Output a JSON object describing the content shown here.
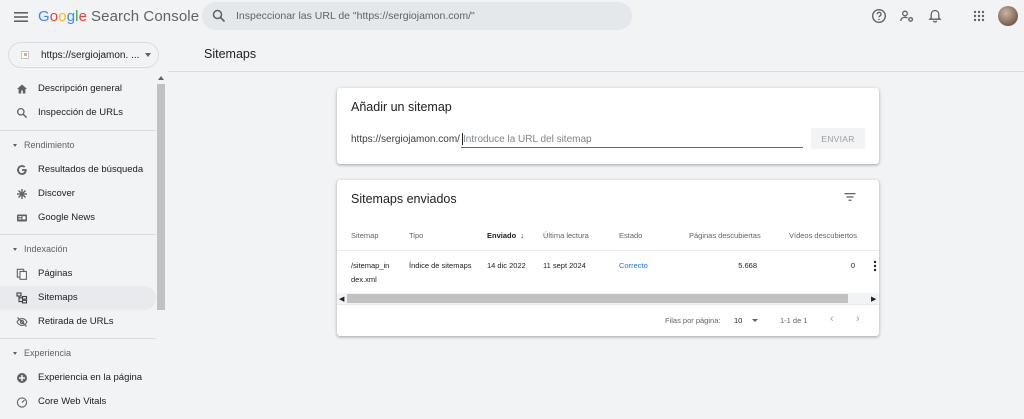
{
  "header": {
    "logo_letters": [
      "G",
      "o",
      "o",
      "g",
      "l",
      "e"
    ],
    "product_name": "Search Console",
    "search_placeholder": "Inspeccionar las URL de \"https://sergiojamon.com/\"",
    "icons": [
      "menu-icon",
      "search-icon",
      "help-icon",
      "users-settings-icon",
      "bell-icon",
      "apps-grid-icon",
      "avatar"
    ]
  },
  "property": {
    "label": "https://sergiojamon. ..."
  },
  "sidebar": {
    "items": [
      {
        "label": "Descripción general",
        "icon": "home-icon"
      },
      {
        "label": "Inspección de URLs",
        "icon": "search-icon"
      },
      {
        "label": "Resultados de búsqueda",
        "icon": "google-g-icon"
      },
      {
        "label": "Discover",
        "icon": "asterisk-icon"
      },
      {
        "label": "Google News",
        "icon": "news-icon"
      },
      {
        "label": "Páginas",
        "icon": "pages-icon"
      },
      {
        "label": "Sitemaps",
        "icon": "sitemap-icon",
        "active": true
      },
      {
        "label": "Retirada de URLs",
        "icon": "eye-off-icon"
      },
      {
        "label": "Experiencia en la página",
        "icon": "plus-circle-icon"
      },
      {
        "label": "Core Web Vitals",
        "icon": "gauge-icon"
      }
    ],
    "sections": [
      "Rendimiento",
      "Indexación",
      "Experiencia"
    ]
  },
  "main": {
    "page_title": "Sitemaps",
    "add_card": {
      "title": "Añadir un sitemap",
      "prefix": "https://sergiojamon.com/",
      "input_placeholder": "Introduce la URL del sitemap",
      "send_label": "ENVIAR"
    },
    "submitted_card": {
      "title": "Sitemaps enviados",
      "columns": [
        "Sitemap",
        "Tipo",
        "Enviado",
        "Última lectura",
        "Estado",
        "Páginas descubiertas",
        "Vídeos descubiertos"
      ],
      "sorted_column": "Enviado",
      "sort_arrow": "↓",
      "rows": [
        {
          "sitemap_line1": "/sitemap_in",
          "sitemap_line2": "dex.xml",
          "type": "Índice de sitemaps",
          "submitted": "14 dic 2022",
          "last_read": "11 sept 2024",
          "status": "Correcto",
          "pages": "5.668",
          "videos": "0"
        }
      ],
      "pagination": {
        "rows_per_page_label": "Filas por página:",
        "rows_per_page": "10",
        "range": "1-1 de 1"
      }
    }
  },
  "colors": {
    "accent": "#1a73e8",
    "background": "#f1f3f4",
    "card": "#ffffff",
    "active_nav": "#e8eaed"
  }
}
